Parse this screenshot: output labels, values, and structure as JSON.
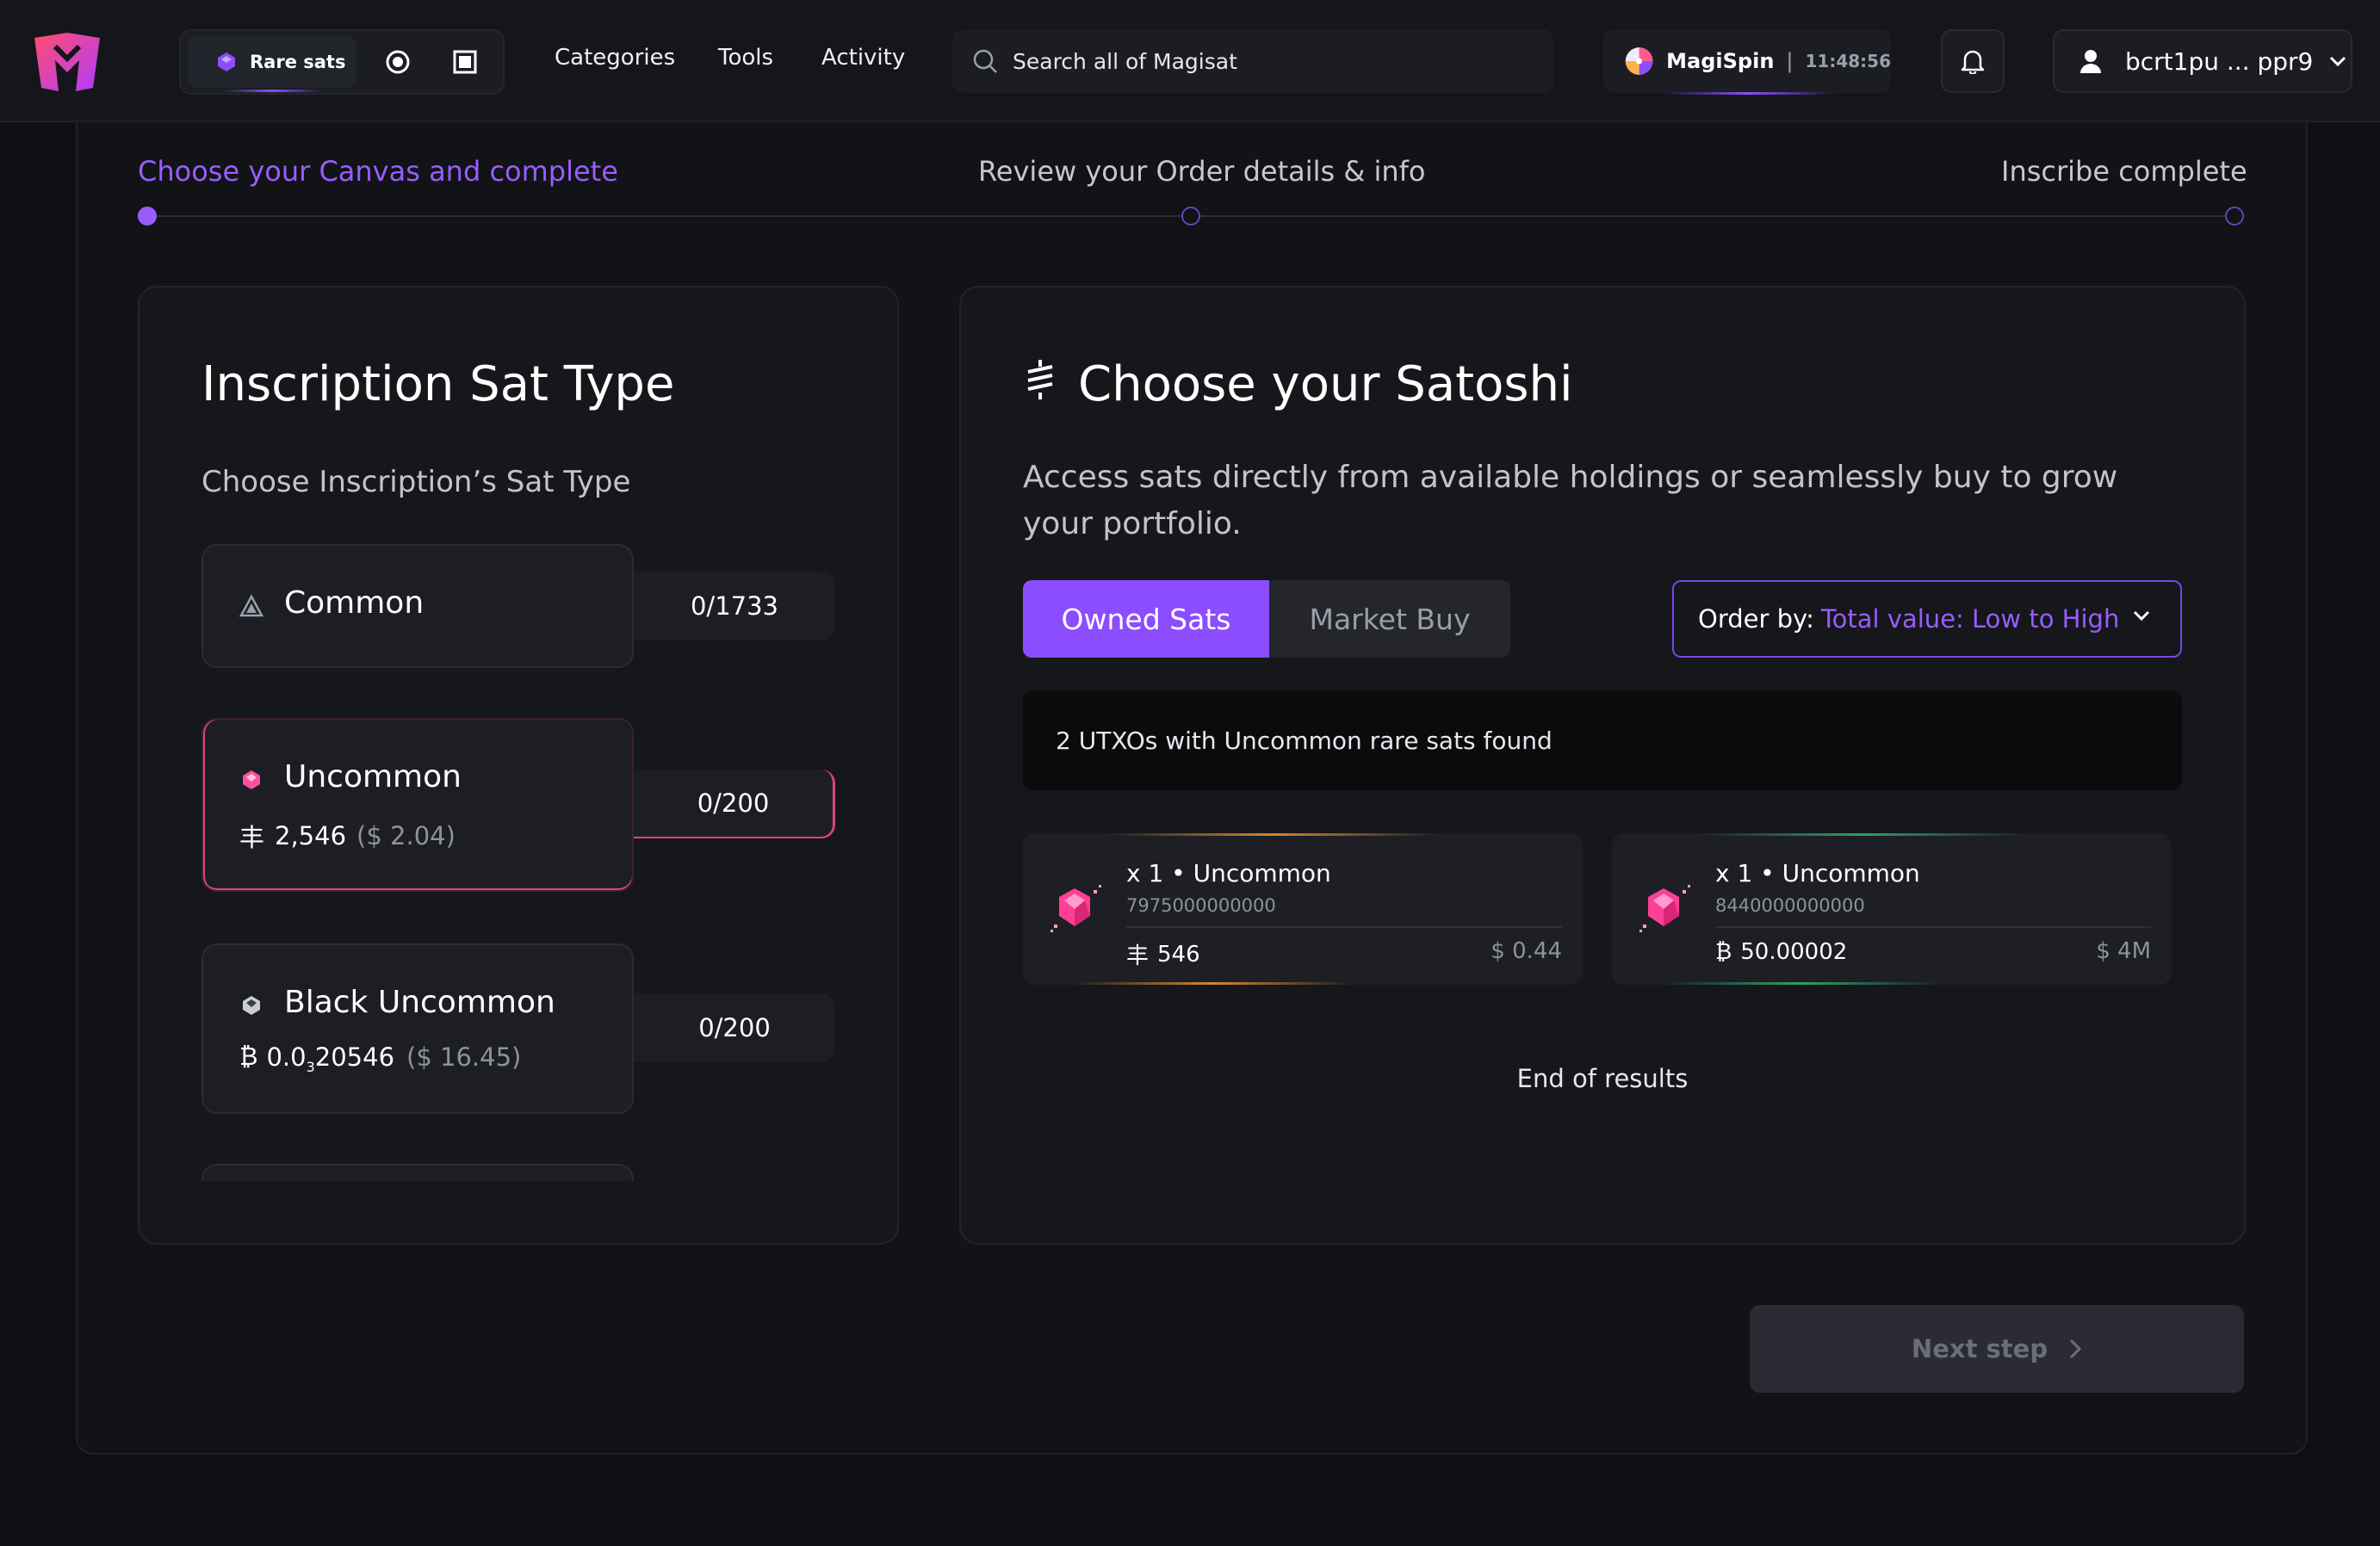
{
  "nav": {
    "rare_sats_label": "Rare sats",
    "links": [
      "Categories",
      "Tools",
      "Activity"
    ],
    "search_placeholder": "Search all of Magisat",
    "magispin_label": "MagiSpin",
    "magispin_separator": "|",
    "magispin_time": "11:48:56",
    "wallet_address": "bcrt1pu ... ppr9"
  },
  "steps": [
    {
      "label": "Choose your Canvas and complete",
      "active": true
    },
    {
      "label": "Review your Order details & info",
      "active": false
    },
    {
      "label": "Inscribe complete",
      "active": false
    }
  ],
  "left_panel": {
    "title": "Inscription Sat Type",
    "subtitle": "Choose Inscription’s Sat Type",
    "types": [
      {
        "name": "Common",
        "count": "0/1733",
        "sat_symbol": "",
        "value": "",
        "usd": ""
      },
      {
        "name": "Uncommon",
        "count": "0/200",
        "sat_symbol": "丰",
        "value": "2,546",
        "usd": "($ 2.04)"
      },
      {
        "name": "Black Uncommon",
        "count": "0/200",
        "sat_symbol": "₿",
        "value_main": "0.0",
        "value_sub": "3",
        "value_rest": "20546",
        "usd": "($ 16.45)"
      }
    ]
  },
  "right_panel": {
    "title": "Choose your Satoshi",
    "description": "Access sats directly from available holdings or seamlessly buy to grow your portfolio.",
    "tabs": [
      "Owned Sats",
      "Market Buy"
    ],
    "order_label": "Order by:",
    "order_value": "Total value: Low to High",
    "info_text": "2 UTXOs with Uncommon rare sats found",
    "utxos": [
      {
        "title": "x 1 • Uncommon",
        "id": "7975000000000",
        "symbol": "丰",
        "amount": "546",
        "usd": "$ 0.44",
        "accent": "#d4862e"
      },
      {
        "title": "x 1 • Uncommon",
        "id": "8440000000000",
        "symbol": "₿",
        "amount": "50.00002",
        "usd": "$ 4M",
        "accent": "#2ea06a"
      }
    ],
    "end_text": "End of results"
  },
  "footer": {
    "next_label": "Next step"
  },
  "colors": {
    "accent_purple": "#8b4dff",
    "accent_pink": "#e0457a"
  }
}
